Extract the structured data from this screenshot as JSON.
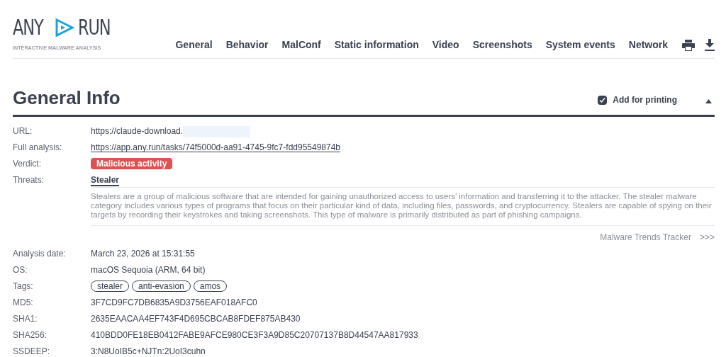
{
  "logo": {
    "left": "ANY",
    "right": "RUN",
    "subtitle": "INTERACTIVE MALWARE ANALYSIS"
  },
  "nav": [
    {
      "label": "General",
      "selected": false
    },
    {
      "label": "Behavior",
      "selected": false
    },
    {
      "label": "MalConf",
      "selected": false
    },
    {
      "label": "Static information",
      "selected": false
    },
    {
      "label": "Video",
      "selected": false
    },
    {
      "label": "Screenshots",
      "selected": false
    },
    {
      "label": "System events",
      "selected": false
    },
    {
      "label": "Network",
      "selected": false
    }
  ],
  "section": {
    "title": "General Info",
    "print_label": "Add for printing",
    "print_checked": true,
    "expanded": true
  },
  "rows": [
    {
      "kind": "redacted",
      "label": "URL:",
      "value": "https://claude-download."
    },
    {
      "kind": "link",
      "label": "Full analysis:",
      "value": "https://app.any.run/tasks/74f5000d-aa91-4745-9fc7-fdd95549874b"
    },
    {
      "kind": "verdict",
      "label": "Verdict:",
      "value": "Malicious activity"
    },
    {
      "kind": "threat",
      "label": "Threats:",
      "value": "Stealer",
      "description": "Stealers are a group of malicious software that are intended for gaining unauthorized access to users’ information and transferring it to the attacker. The stealer malware category includes various types of programs that focus on their particular kind of data, including files, passwords, and cryptocurrency. Stealers are capable of spying on their targets by recording their keystrokes and taking screenshots. This type of malware is primarily distributed as part of phishing campaigns.",
      "tracker": "Malware Trends Tracker",
      "tracker_arrow": ">>>"
    },
    {
      "kind": "text",
      "label": "Analysis date:",
      "value": "March 23, 2026 at 15:31:55"
    },
    {
      "kind": "text",
      "label": "OS:",
      "value": "macOS Sequoia (ARM, 64 bit)"
    },
    {
      "kind": "tags",
      "label": "Tags:",
      "tags": [
        "stealer",
        "anti-evasion",
        "amos"
      ]
    },
    {
      "kind": "text",
      "label": "MD5:",
      "value": "3F7CD9FC7DB6835A9D3756EAF018AFC0"
    },
    {
      "kind": "text",
      "label": "SHA1:",
      "value": "2635EAACAA4EF743F4D695CBCAB8FDEF875AB430"
    },
    {
      "kind": "text",
      "label": "SHA256:",
      "value": "410BDD0FE18EB0412FABE9AFCE980CE3F3A9D85C20707137B8D44547AA817933"
    },
    {
      "kind": "text",
      "label": "SSDEEP:",
      "value": "3:N8UoIB5c+NJTn:2UoI3cuhn"
    }
  ]
}
